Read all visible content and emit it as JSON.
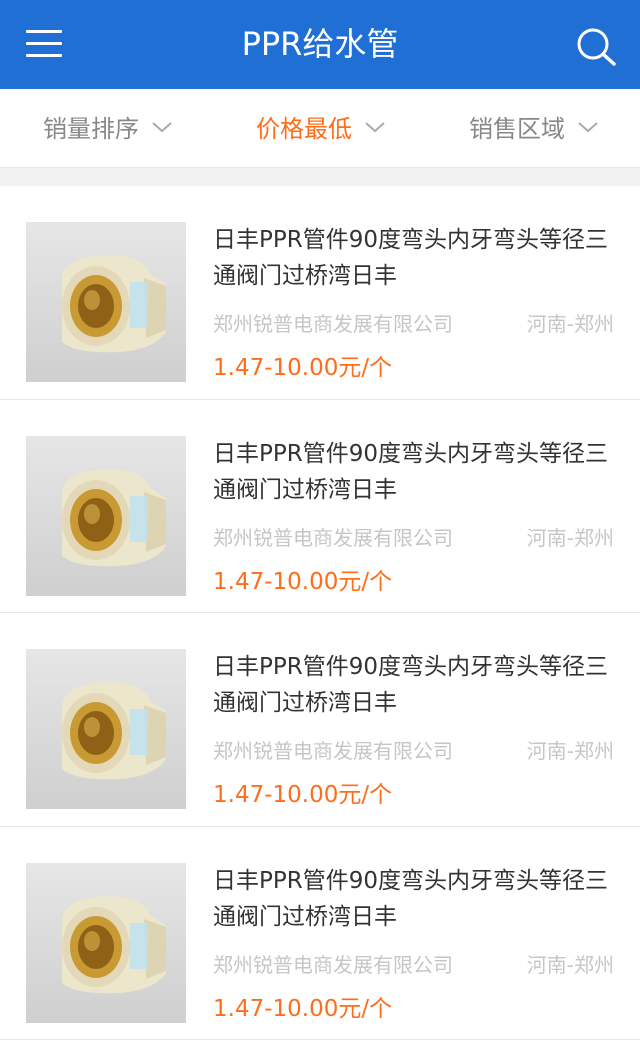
{
  "header": {
    "title": "PPR给水管",
    "menu_icon": "menu-icon",
    "search_icon": "search-icon",
    "background": "#1f6fd5"
  },
  "filters": [
    {
      "label": "销量排序",
      "active": false
    },
    {
      "label": "价格最低",
      "active": true
    },
    {
      "label": "销售区域",
      "active": false
    }
  ],
  "colors": {
    "accent": "#ff6d1a",
    "muted": "#c6c6c6"
  },
  "products": [
    {
      "title": "日丰PPR管件90度弯头内牙弯头等径三通阀门过桥湾日丰",
      "company": "郑州锐普电商发展有限公司",
      "region": "河南-郑州",
      "price": "1.47-10.00元/个"
    },
    {
      "title": "日丰PPR管件90度弯头内牙弯头等径三通阀门过桥湾日丰",
      "company": "郑州锐普电商发展有限公司",
      "region": "河南-郑州",
      "price": "1.47-10.00元/个"
    },
    {
      "title": "日丰PPR管件90度弯头内牙弯头等径三通阀门过桥湾日丰",
      "company": "郑州锐普电商发展有限公司",
      "region": "河南-郑州",
      "price": "1.47-10.00元/个"
    },
    {
      "title": "日丰PPR管件90度弯头内牙弯头等径三通阀门过桥湾日丰",
      "company": "郑州锐普电商发展有限公司",
      "region": "河南-郑州",
      "price": "1.47-10.00元/个"
    }
  ]
}
